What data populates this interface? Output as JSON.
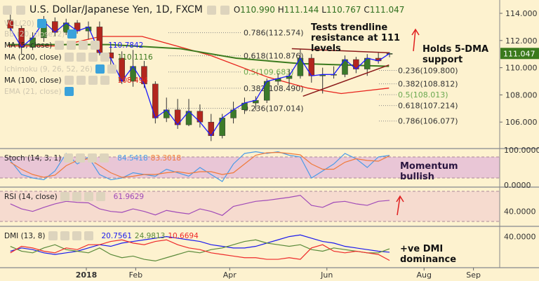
{
  "header": {
    "symbol": "U.S. Dollar/Japanese Yen, 1D, FXCM",
    "open_label": "O",
    "open": "110.990",
    "high_label": "H",
    "high": "111.144",
    "low_label": "L",
    "low": "110.767",
    "close_label": "C",
    "close": "111.047"
  },
  "legends": {
    "vol": "VOL(20)",
    "bb": "BB (20, close, 2)",
    "ma5": {
      "label": "MA (5, close)",
      "value": "110.7842"
    },
    "ma200": {
      "label": "MA (200, close)",
      "value": "110.1116"
    },
    "ichimoku": "Ichimoku (9, 26, 52, 26)",
    "ma100": {
      "label": "MA (100, close)",
      "value": "108.494"
    },
    "ema": "EMA (21, close)",
    "stoch": {
      "label": "Stoch (14, 3, 1)",
      "k": "84.5418",
      "d": "83.3018"
    },
    "rsi": {
      "label": "RSI (14, close)",
      "value": "61.9629"
    },
    "dmi": {
      "label": "DMI (13, 8)",
      "adx": "20.7561",
      "plus_di": "24.9813",
      "minus_di": "10.6694"
    }
  },
  "annotations": {
    "resistance": "Tests trendline resistance at 111 levels",
    "support": "Holds 5-DMA support",
    "momentum": "Momentum bullish",
    "dmi": "+ve DMI dominance"
  },
  "colors": {
    "background": "#fdf2cf",
    "bull_candle": "#3c7a2a",
    "bear_candle": "#b3261e",
    "ma5": "#1a1aff",
    "ma100": "#e8221b",
    "ma200": "#3b7a1e",
    "stoch_k": "#4a9be8",
    "stoch_d": "#f07a3a",
    "rsi": "#a04ab8",
    "adx": "#1a1aee",
    "plus_di": "#5a8a3a",
    "minus_di": "#ee2a2a",
    "price_tag": "#3a7a1c"
  },
  "chart_data": [
    {
      "type": "candlestick",
      "title": "U.S. Dollar/Japanese Yen, 1D, FXCM",
      "ylim": [
        104.3,
        115
      ],
      "yticks": [
        "114.000",
        "112.000",
        "110.000",
        "108.000",
        "106.000"
      ],
      "xticks": [
        "2018",
        "Feb",
        "Apr",
        "Jun",
        "Aug",
        "Sep"
      ],
      "current_price": "111.047",
      "dates": [
        "2017-11-13",
        "2017-11-20",
        "2017-11-27",
        "2017-12-04",
        "2017-12-11",
        "2017-12-18",
        "2017-12-25",
        "2018-01-01",
        "2018-01-08",
        "2018-01-15",
        "2018-01-22",
        "2018-01-29",
        "2018-02-05",
        "2018-02-12",
        "2018-02-19",
        "2018-02-26",
        "2018-03-05",
        "2018-03-12",
        "2018-03-19",
        "2018-03-26",
        "2018-04-02",
        "2018-04-09",
        "2018-04-16",
        "2018-04-23",
        "2018-04-30",
        "2018-05-07",
        "2018-05-14",
        "2018-05-21",
        "2018-05-28",
        "2018-06-04",
        "2018-06-11",
        "2018-06-18",
        "2018-06-25",
        "2018-07-02",
        "2018-07-09"
      ],
      "open": [
        113.5,
        112.9,
        111.5,
        112.2,
        113.4,
        112.6,
        113.3,
        112.7,
        113.0,
        111.1,
        110.7,
        109.0,
        110.1,
        108.8,
        106.3,
        106.9,
        105.8,
        106.8,
        106.0,
        105.0,
        106.3,
        106.9,
        107.4,
        107.6,
        109.0,
        109.2,
        109.4,
        110.7,
        109.4,
        109.5,
        109.5,
        110.6,
        109.9,
        110.7,
        110.99
      ],
      "high": [
        113.9,
        113.1,
        112.6,
        113.8,
        113.7,
        113.6,
        113.5,
        113.4,
        113.4,
        111.6,
        111.2,
        111.3,
        110.5,
        109.0,
        107.8,
        107.7,
        107.7,
        107.3,
        106.6,
        106.6,
        107.5,
        107.8,
        107.9,
        109.2,
        109.6,
        109.9,
        111.4,
        111.0,
        110.0,
        110.1,
        110.9,
        110.8,
        111.0,
        111.1,
        111.144
      ],
      "low": [
        112.6,
        111.0,
        111.3,
        111.9,
        112.3,
        112.4,
        112.5,
        112.1,
        110.9,
        110.2,
        108.8,
        108.6,
        108.5,
        105.9,
        106.0,
        105.5,
        105.7,
        105.6,
        104.6,
        104.8,
        105.9,
        106.6,
        106.9,
        107.4,
        108.7,
        108.6,
        109.2,
        108.9,
        108.1,
        109.2,
        109.3,
        109.6,
        109.4,
        110.3,
        110.767
      ],
      "close": [
        112.9,
        111.5,
        112.2,
        113.4,
        112.6,
        113.3,
        112.7,
        113.0,
        111.1,
        110.7,
        109.0,
        110.1,
        108.8,
        106.3,
        106.9,
        105.8,
        106.8,
        106.0,
        105.0,
        106.3,
        106.9,
        107.4,
        107.6,
        109.0,
        109.2,
        109.4,
        110.7,
        109.4,
        109.5,
        109.5,
        110.6,
        109.9,
        110.7,
        110.5,
        111.047
      ],
      "ma100": {
        "dates": [
          "2017-11-13",
          "2017-12-15",
          "2018-01-10",
          "2018-02-05",
          "2018-03-20",
          "2018-04-25",
          "2018-05-20",
          "2018-06-10",
          "2018-07-10"
        ],
        "values": [
          111.6,
          111.6,
          112.3,
          112.3,
          110.9,
          109.3,
          108.5,
          108.1,
          108.5
        ]
      },
      "ma200": {
        "dates": [
          "2017-11-13",
          "2018-01-15",
          "2018-03-01",
          "2018-04-05",
          "2018-05-15",
          "2018-07-10"
        ],
        "values": [
          111.7,
          111.7,
          111.4,
          110.7,
          110.3,
          110.1
        ]
      },
      "fib_left": [
        {
          "label": "0.786(112.574)",
          "price": 112.574
        },
        {
          "label": "0.618(110.876)",
          "price": 110.876
        },
        {
          "label": "0.5(109.683)",
          "price": 109.683,
          "highlight": true
        },
        {
          "label": "0.382(108.490)",
          "price": 108.49
        },
        {
          "label": "0.236(107.014)",
          "price": 107.014
        }
      ],
      "fib_right": [
        {
          "label": "0.236(109.800)",
          "price": 109.8
        },
        {
          "label": "0.382(108.812)",
          "price": 108.812
        },
        {
          "label": "0.5(108.013)",
          "price": 108.013,
          "highlight": true
        },
        {
          "label": "0.618(107.214)",
          "price": 107.214
        },
        {
          "label": "0.786(106.077)",
          "price": 106.077
        }
      ],
      "trendlines": [
        {
          "name": "resistance",
          "from": [
            "2018-05-10",
            111.4
          ],
          "to": [
            "2018-07-10",
            111.1
          ]
        },
        {
          "name": "support",
          "from": [
            "2018-05-17",
            107.9
          ],
          "to": [
            "2018-07-10",
            110.2
          ]
        }
      ]
    },
    {
      "type": "line",
      "title": "Stoch (14, 3, 1)",
      "ylim": [
        0,
        100
      ],
      "yticks": [
        "100.0000",
        "0.0000"
      ],
      "bands": [
        20,
        80
      ],
      "series": [
        {
          "name": "%K",
          "values": [
            70,
            30,
            20,
            15,
            40,
            90,
            60,
            80,
            30,
            15,
            20,
            35,
            30,
            25,
            45,
            35,
            25,
            50,
            30,
            10,
            60,
            90,
            95,
            90,
            95,
            85,
            80,
            20,
            40,
            60,
            90,
            75,
            50,
            80,
            84.5418
          ]
        },
        {
          "name": "%D",
          "values": [
            65,
            45,
            30,
            22,
            28,
            55,
            70,
            75,
            55,
            35,
            22,
            25,
            30,
            30,
            35,
            38,
            33,
            38,
            38,
            30,
            35,
            60,
            85,
            92,
            93,
            90,
            86,
            60,
            45,
            45,
            65,
            75,
            70,
            68,
            83.3018
          ]
        }
      ]
    },
    {
      "type": "line",
      "title": "RSI (14, close)",
      "ylim": [
        20,
        80
      ],
      "yticks": [
        "40.0000"
      ],
      "bands": [
        30,
        70
      ],
      "series": [
        {
          "name": "RSI",
          "values": [
            55,
            45,
            40,
            48,
            55,
            60,
            58,
            57,
            45,
            40,
            38,
            45,
            40,
            33,
            42,
            38,
            35,
            45,
            40,
            32,
            50,
            55,
            60,
            62,
            65,
            68,
            72,
            52,
            48,
            58,
            60,
            55,
            52,
            60,
            61.9629
          ]
        }
      ]
    },
    {
      "type": "line",
      "title": "DMI (13, 8)",
      "ylim": [
        0,
        50
      ],
      "yticks": [
        "40.0000"
      ],
      "series": [
        {
          "name": "ADX",
          "values": [
            22,
            26,
            24,
            20,
            18,
            20,
            22,
            26,
            30,
            28,
            32,
            34,
            36,
            38,
            40,
            38,
            36,
            34,
            30,
            28,
            26,
            26,
            28,
            32,
            36,
            40,
            42,
            38,
            34,
            32,
            28,
            26,
            24,
            22,
            20.7561
          ]
        },
        {
          "name": "+DI",
          "values": [
            28,
            22,
            20,
            26,
            30,
            24,
            22,
            20,
            26,
            18,
            14,
            16,
            12,
            10,
            14,
            18,
            22,
            20,
            24,
            26,
            30,
            34,
            36,
            32,
            30,
            28,
            30,
            24,
            22,
            26,
            24,
            22,
            20,
            20,
            24.9813
          ]
        },
        {
          "name": "-DI",
          "values": [
            20,
            28,
            26,
            22,
            20,
            26,
            24,
            30,
            30,
            34,
            36,
            32,
            30,
            34,
            36,
            30,
            26,
            24,
            20,
            18,
            16,
            14,
            14,
            12,
            12,
            14,
            12,
            26,
            30,
            22,
            20,
            22,
            20,
            18,
            10.6694
          ]
        }
      ]
    }
  ]
}
